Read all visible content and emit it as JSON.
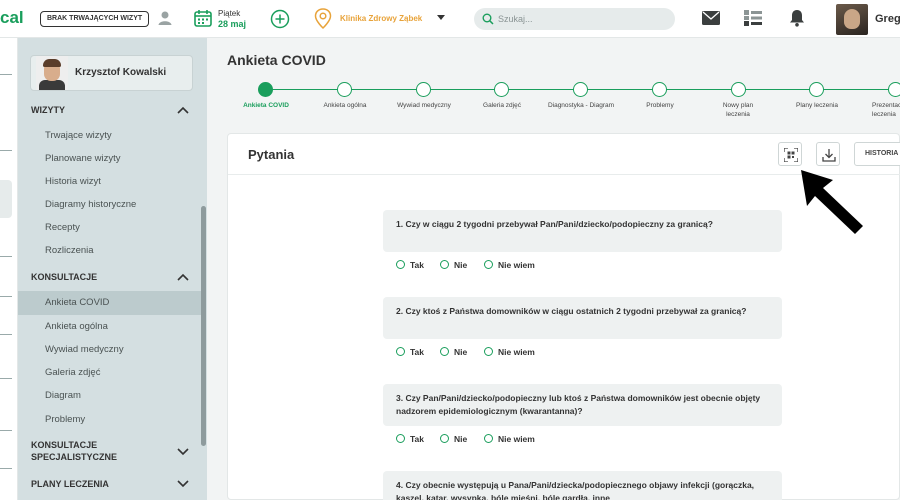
{
  "header": {
    "logo_fragment": "cal",
    "visit_badge": "BRAK TRWAJĄCYCH WIZYT",
    "date_day": "Piątek",
    "date_num": "28 maj",
    "clinic": "Klinika Zdrowy Ząbek",
    "search_placeholder": "Szukaj...",
    "user_name": "Greg"
  },
  "sidebar": {
    "profile_name": "Krzysztof Kowalski",
    "sections": [
      {
        "title": "WIZYTY",
        "items": [
          "Trwające wizyty",
          "Planowane wizyty",
          "Historia wizyt",
          "Diagramy historyczne",
          "Recepty",
          "Rozliczenia"
        ]
      },
      {
        "title": "KONSULTACJE",
        "items": [
          "Ankieta COVID",
          "Ankieta ogólna",
          "Wywiad medyczny",
          "Galeria zdjęć",
          "Diagram",
          "Problemy"
        ]
      },
      {
        "title": "KONSULTACJE SPECJALISTYCZNE",
        "items": []
      },
      {
        "title": "PLANY LECZENIA",
        "items": []
      }
    ],
    "active_item": "Ankieta COVID"
  },
  "main": {
    "page_title": "Ankieta COVID",
    "steps": [
      "Ankieta COVID",
      "Ankieta ogólna",
      "Wywiad medyczny",
      "Galeria zdjęć",
      "Diagnostyka - Diagram",
      "Problemy",
      "Nowy plan leczenia",
      "Plany leczenia",
      "Prezentacja leczenia"
    ],
    "panel_title": "Pytania",
    "history_button": "HISTORIA",
    "answer_options": [
      "Tak",
      "Nie",
      "Nie wiem"
    ],
    "questions": [
      "1. Czy w ciągu 2 tygodni przebywał Pan/Pani/dziecko/podopieczny za granicą?",
      "2. Czy ktoś z Państwa domowników w ciągu ostatnich 2 tygodni przebywał za granicą?",
      "3. Czy Pan/Pani/dziecko/podopieczny lub ktoś z Państwa domowników jest obecnie objęty nadzorem epidemiologicznym (kwarantanna)?",
      "4. Czy obecnie występują u Pana/Pani/dziecka/podopiecznego objawy infekcji (gorączka, kaszel, katar, wysypka, bóle mięśni, bóle gardła, inne"
    ]
  },
  "colors": {
    "accent": "#1a9e5c",
    "clinic": "#e8a33a",
    "sidebar_bg": "#d4dfe1"
  },
  "icons": [
    "user-icon",
    "calendar-icon",
    "add-icon",
    "location-pin-icon",
    "search-icon",
    "mail-icon",
    "grid-list-icon",
    "bell-icon",
    "qr-code-icon",
    "download-icon",
    "chevron-up-icon",
    "chevron-down-icon"
  ]
}
